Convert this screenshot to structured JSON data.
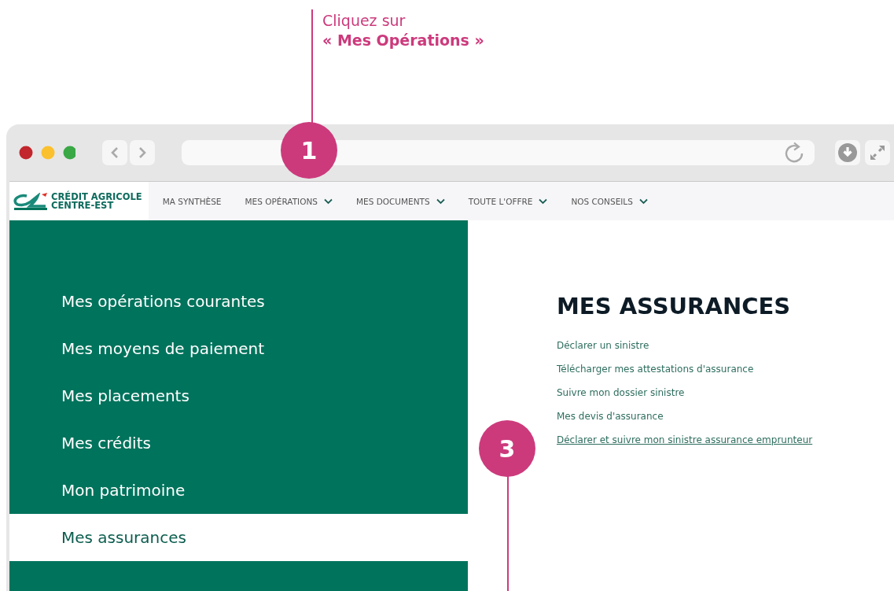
{
  "instruction": {
    "line_1": "Cliquez sur",
    "line_2": "« Mes Opérations »"
  },
  "step_markers": [
    {
      "number": "1"
    },
    {
      "number": "3"
    }
  ],
  "site": {
    "logo_line_1": "CRÉDIT AGRICOLE",
    "logo_line_2": "CENTRE-EST",
    "nav": [
      {
        "label": "MA SYNTHÈSE",
        "has_dropdown": false
      },
      {
        "label": "MES OPÉRATIONS",
        "has_dropdown": true
      },
      {
        "label": "MES DOCUMENTS",
        "has_dropdown": true
      },
      {
        "label": "TOUTE L'OFFRE",
        "has_dropdown": true
      },
      {
        "label": "NOS CONSEILS",
        "has_dropdown": true
      }
    ],
    "sidebar": [
      {
        "label": "Mes opérations courantes",
        "selected": false
      },
      {
        "label": "Mes moyens de paiement",
        "selected": false
      },
      {
        "label": "Mes placements",
        "selected": false
      },
      {
        "label": "Mes crédits",
        "selected": false
      },
      {
        "label": "Mon patrimoine",
        "selected": false
      },
      {
        "label": "Mes assurances",
        "selected": true
      }
    ],
    "section_title": "MES ASSURANCES",
    "links": [
      {
        "label": "Déclarer un sinistre",
        "underlined": false
      },
      {
        "label": "Télécharger mes attestations d'assurance",
        "underlined": false
      },
      {
        "label": "Suivre mon dossier sinistre",
        "underlined": false
      },
      {
        "label": "Mes devis d'assurance",
        "underlined": false
      },
      {
        "label": "Déclarer et suivre mon sinistre assurance emprunteur",
        "underlined": true
      }
    ]
  }
}
